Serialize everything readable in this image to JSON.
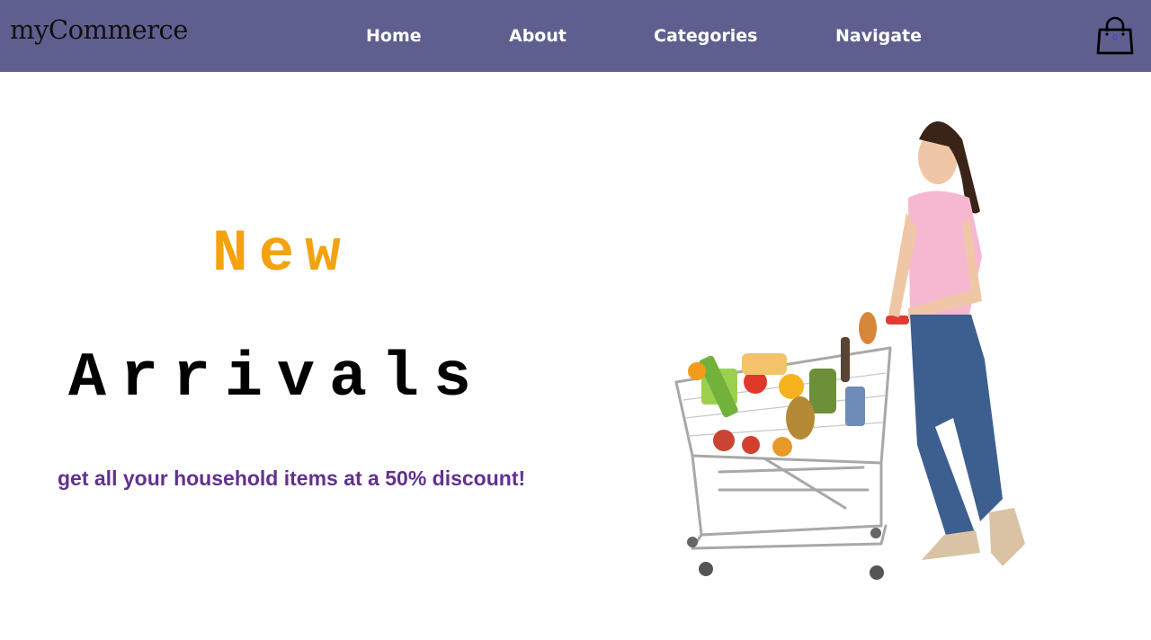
{
  "navbar": {
    "logo": "myCommerce",
    "links": [
      {
        "label": "Home"
      },
      {
        "label": "About"
      },
      {
        "label": "Categories"
      },
      {
        "label": "Navigate"
      }
    ],
    "cart": {
      "icon": "shopping-bag-icon",
      "count": "0"
    },
    "background_color": "#5f5f8f"
  },
  "hero": {
    "headline_1": "New",
    "headline_2": "Arrivals",
    "tagline": "get all your household items at a 50% discount!",
    "image_description": "woman-pushing-grocery-cart",
    "colors": {
      "headline_1": "#f5a20f",
      "headline_2": "#000000",
      "tagline": "#62318f"
    }
  }
}
